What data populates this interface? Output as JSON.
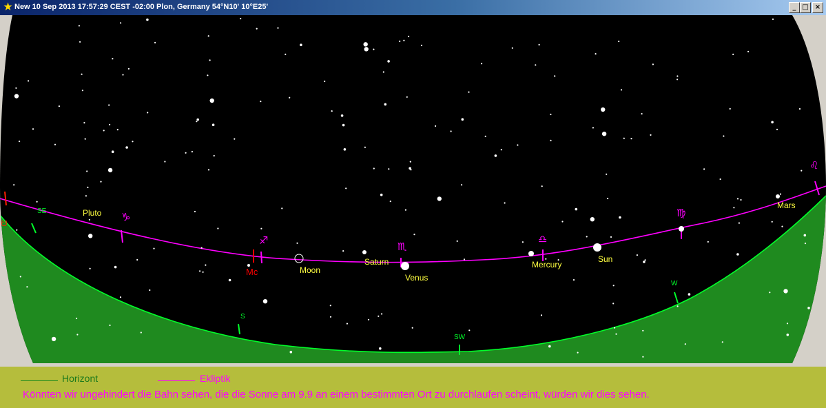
{
  "window": {
    "title": "New 10 Sep 2013 17:57:29 CEST -02:00 Plon, Germany 54°N10' 10°E25'",
    "icon": "star-icon",
    "buttons": [
      "minimize",
      "maximize",
      "close"
    ]
  },
  "colors": {
    "sky": "#000000",
    "ground": "#1f8a1f",
    "horizon": "#00ff2a",
    "ecliptic": "#ff00ff",
    "planet_label": "#ffff40",
    "mc": "#ff0000",
    "legend_bg": "#b5bd3c"
  },
  "sky": {
    "bodies": [
      {
        "name": "Pluto"
      },
      {
        "name": "Moon"
      },
      {
        "name": "Saturn"
      },
      {
        "name": "Venus"
      },
      {
        "name": "Mercury"
      },
      {
        "name": "Sun"
      },
      {
        "name": "Mars"
      }
    ],
    "mc_label": "Mc",
    "compass": {
      "se": "SE",
      "s": "S",
      "sw": "SW",
      "w": "W"
    },
    "zodiac": {
      "capricorn": "♑",
      "sagittarius": "♐",
      "scorpio": "♏",
      "libra": "♎",
      "virgo": "♍",
      "leo": "♌"
    }
  },
  "legend": {
    "horizon_label": "Horizont",
    "ecliptic_label": "Ekliptik",
    "caption": "Könnten wir ungehindert die Bahn sehen, die die Sonne am 9.9 an einem bestimmten Ort zu durchlaufen scheint, würden wir dies sehen."
  }
}
